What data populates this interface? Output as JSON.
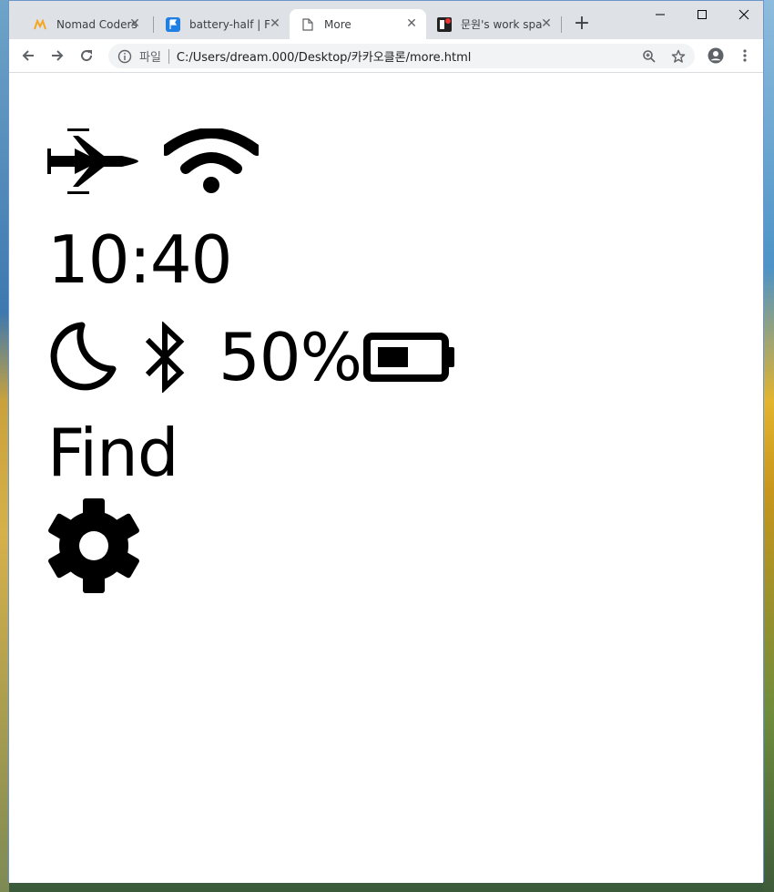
{
  "browser": {
    "tabs": [
      {
        "title": "Nomad Coders",
        "favicon": "nomad-coders-logo",
        "active": false
      },
      {
        "title": "battery-half | Fo",
        "favicon": "flag-icon",
        "active": false
      },
      {
        "title": "More",
        "favicon": "page-icon",
        "active": true
      },
      {
        "title": "문원's work spa",
        "favicon": "workspace-app-icon",
        "active": false
      }
    ],
    "close_glyph": "✕",
    "new_tab_glyph": "+",
    "address": {
      "scheme_label": "파일",
      "url": "C:/Users/dream.000/Desktop/카카오클론/more.html"
    }
  },
  "page": {
    "status_icons": [
      "airplane-icon",
      "wifi-icon"
    ],
    "time": "10:40",
    "battery_percent": "50%",
    "battery_level": 0.5,
    "find_label": "Find",
    "settings_icon": "gear-icon"
  }
}
